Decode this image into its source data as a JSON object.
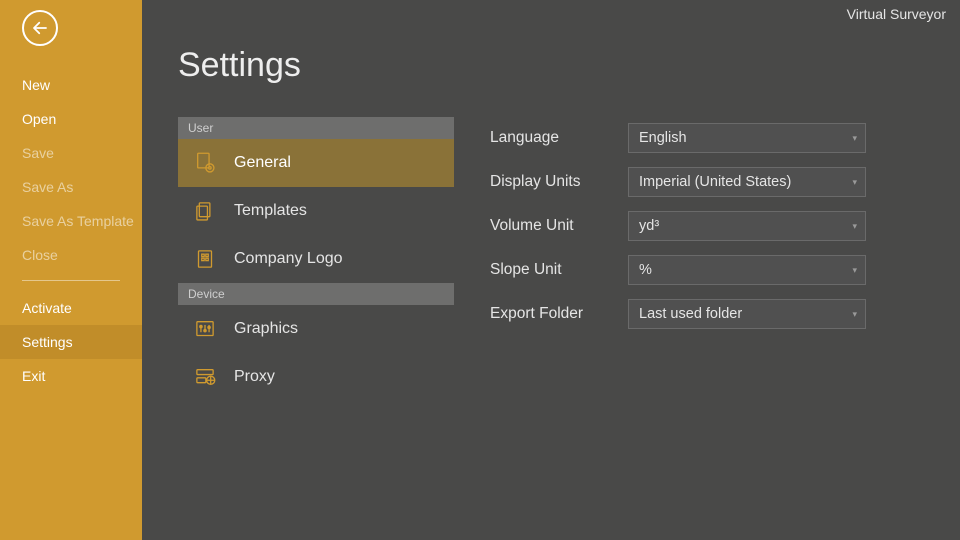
{
  "app_title": "Virtual Surveyor",
  "page_title": "Settings",
  "sidebar": {
    "groups": [
      [
        {
          "label": "New",
          "dim": false,
          "active": false
        },
        {
          "label": "Open",
          "dim": false,
          "active": false
        },
        {
          "label": "Save",
          "dim": true,
          "active": false
        },
        {
          "label": "Save As",
          "dim": true,
          "active": false
        },
        {
          "label": "Save As Template",
          "dim": true,
          "active": false
        },
        {
          "label": "Close",
          "dim": true,
          "active": false
        }
      ],
      [
        {
          "label": "Activate",
          "dim": false,
          "active": false
        },
        {
          "label": "Settings",
          "dim": false,
          "active": true
        },
        {
          "label": "Exit",
          "dim": false,
          "active": false
        }
      ]
    ]
  },
  "categories": {
    "sections": [
      {
        "header": "User",
        "items": [
          {
            "label": "General",
            "icon": "gear-doc-icon",
            "active": true
          },
          {
            "label": "Templates",
            "icon": "templates-icon",
            "active": false
          },
          {
            "label": "Company Logo",
            "icon": "logo-icon",
            "active": false
          }
        ]
      },
      {
        "header": "Device",
        "items": [
          {
            "label": "Graphics",
            "icon": "sliders-icon",
            "active": false
          },
          {
            "label": "Proxy",
            "icon": "proxy-icon",
            "active": false
          }
        ]
      }
    ]
  },
  "form": [
    {
      "label": "Language",
      "value": "English"
    },
    {
      "label": "Display Units",
      "value": "Imperial (United States)"
    },
    {
      "label": "Volume Unit",
      "value": "yd³"
    },
    {
      "label": "Slope Unit",
      "value": "%"
    },
    {
      "label": "Export Folder",
      "value": "Last used folder"
    }
  ],
  "icons": {
    "back": "arrow-left-icon",
    "chevron": "▾"
  },
  "colors": {
    "accent": "#d09a2f",
    "bg": "#494948",
    "panel_header": "#6e6e6d",
    "row_active": "#8a7238"
  }
}
